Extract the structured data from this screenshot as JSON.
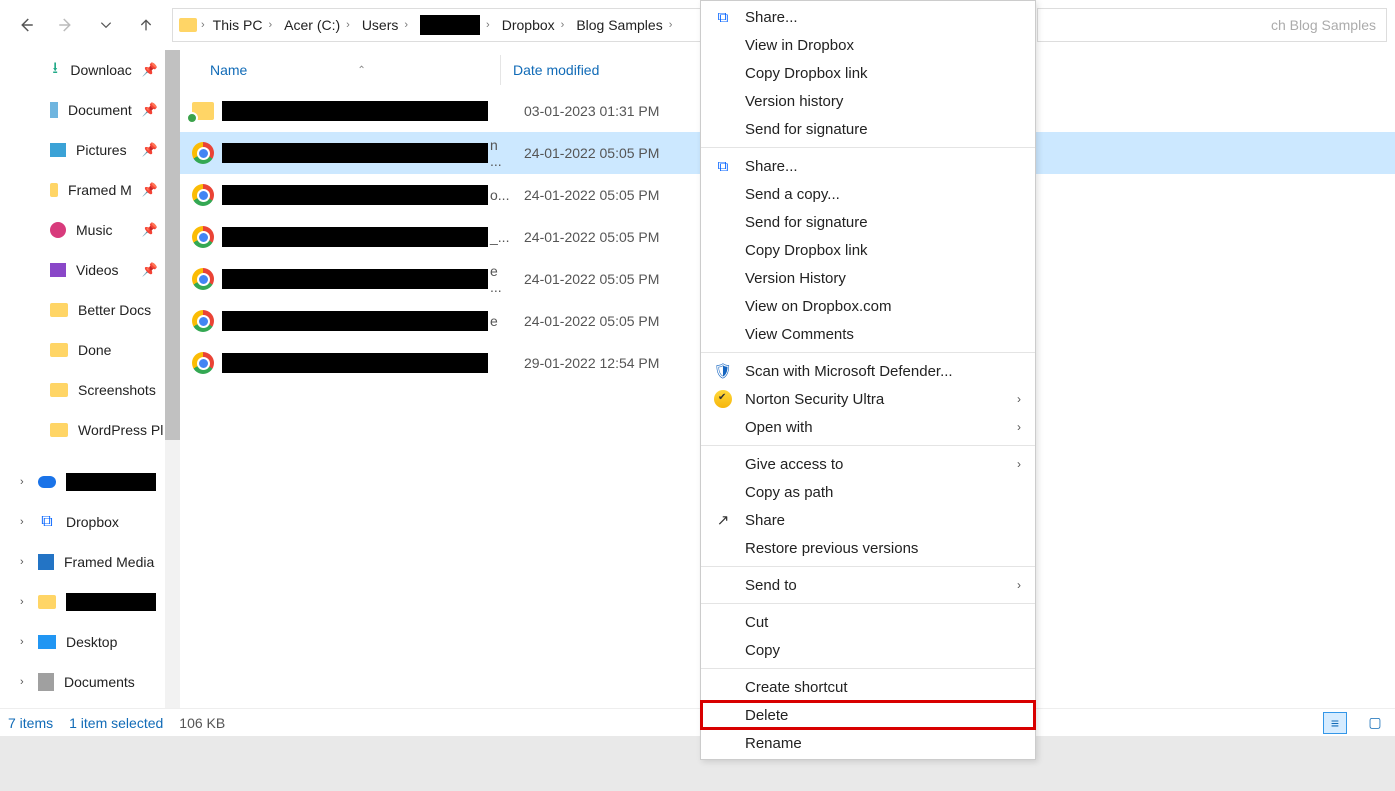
{
  "breadcrumb": [
    "This PC",
    "Acer (C:)",
    "Users",
    "",
    "Dropbox",
    "Blog Samples"
  ],
  "search_placeholder": "Search Blog Samples",
  "search_visible_tail": "ch Blog Samples",
  "sidebar": {
    "pinned": [
      {
        "label": "Downloads",
        "icon": "download",
        "truncated": "Downloac"
      },
      {
        "label": "Documents",
        "icon": "doc",
        "truncated": "Document"
      },
      {
        "label": "Pictures",
        "icon": "pic",
        "truncated": "Pictures"
      },
      {
        "label": "Framed Media",
        "icon": "folder",
        "truncated": "Framed M"
      },
      {
        "label": "Music",
        "icon": "music",
        "truncated": "Music"
      },
      {
        "label": "Videos",
        "icon": "video",
        "truncated": "Videos"
      }
    ],
    "folders": [
      {
        "label": "Better Docs"
      },
      {
        "label": "Done"
      },
      {
        "label": "Screenshots"
      },
      {
        "label": "WordPress Pl",
        "truncated": "WordPress Pl"
      }
    ],
    "roots": [
      {
        "label": "",
        "icon": "cloud",
        "redacted": true
      },
      {
        "label": "Dropbox",
        "icon": "dropbox"
      },
      {
        "label": "Framed Media",
        "icon": "framed"
      },
      {
        "label": "",
        "icon": "folder",
        "redacted": true
      },
      {
        "label": "Desktop",
        "icon": "desktop"
      },
      {
        "label": "Documents",
        "icon": "docgray"
      }
    ]
  },
  "columns": {
    "name": "Name",
    "date": "Date modified"
  },
  "files": [
    {
      "icon": "folder",
      "date": "03-01-2023 01:31 PM",
      "tail": ""
    },
    {
      "icon": "chrome",
      "date": "24-01-2022 05:05 PM",
      "tail": "n ...",
      "selected": true
    },
    {
      "icon": "chrome",
      "date": "24-01-2022 05:05 PM",
      "tail": "o..."
    },
    {
      "icon": "chrome",
      "date": "24-01-2022 05:05 PM",
      "tail": "_..."
    },
    {
      "icon": "chrome",
      "date": "24-01-2022 05:05 PM",
      "tail": "e ..."
    },
    {
      "icon": "chrome",
      "date": "24-01-2022 05:05 PM",
      "tail": "e"
    },
    {
      "icon": "chrome",
      "date": "29-01-2022 12:54 PM",
      "tail": ""
    }
  ],
  "status": {
    "items": "7 items",
    "selected": "1 item selected",
    "size": "106 KB"
  },
  "context_menu": [
    {
      "label": "Share...",
      "icon": "dropbox"
    },
    {
      "label": "View in Dropbox"
    },
    {
      "label": "Copy Dropbox link"
    },
    {
      "label": "Version history"
    },
    {
      "label": "Send for signature"
    },
    {
      "sep": true
    },
    {
      "label": "Share...",
      "icon": "dropbox"
    },
    {
      "label": "Send a copy..."
    },
    {
      "label": "Send for signature"
    },
    {
      "label": "Copy Dropbox link"
    },
    {
      "label": "Version History"
    },
    {
      "label": "View on Dropbox.com"
    },
    {
      "label": "View Comments"
    },
    {
      "sep": true
    },
    {
      "label": "Scan with Microsoft Defender...",
      "icon": "shield"
    },
    {
      "label": "Norton Security Ultra",
      "icon": "norton",
      "sub": true
    },
    {
      "label": "Open with",
      "sub": true
    },
    {
      "sep": true
    },
    {
      "label": "Give access to",
      "sub": true
    },
    {
      "label": "Copy as path"
    },
    {
      "label": "Share",
      "icon": "share"
    },
    {
      "label": "Restore previous versions"
    },
    {
      "sep": true
    },
    {
      "label": "Send to",
      "sub": true
    },
    {
      "sep": true
    },
    {
      "label": "Cut"
    },
    {
      "label": "Copy"
    },
    {
      "sep": true
    },
    {
      "label": "Create shortcut"
    },
    {
      "label": "Delete",
      "highlight": true
    },
    {
      "label": "Rename"
    }
  ]
}
